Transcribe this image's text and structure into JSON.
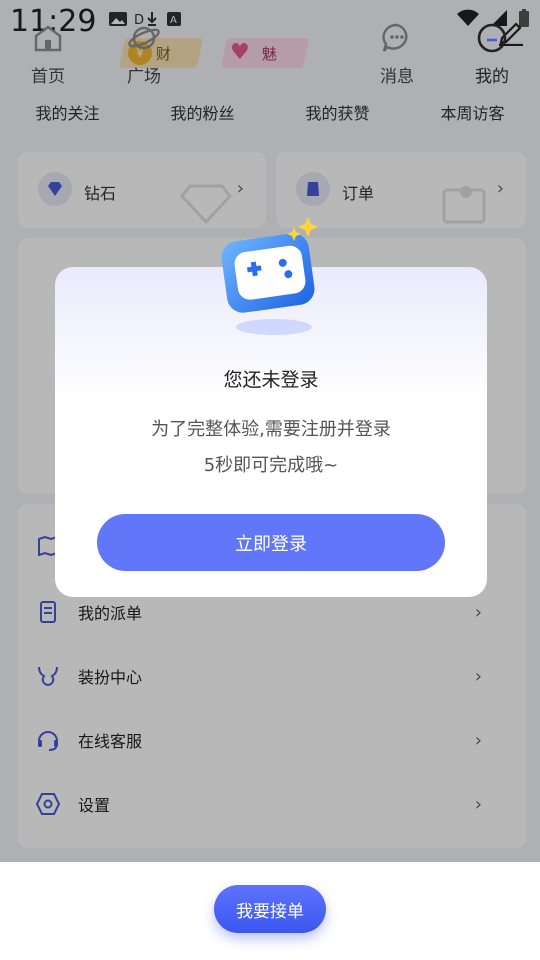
{
  "status_bar": {
    "time": "11:29"
  },
  "badges": {
    "wealth_label": "财",
    "charm_label": "魅"
  },
  "stats": [
    "我的关注",
    "我的粉丝",
    "我的获赞",
    "本周访客"
  ],
  "cards": {
    "diamond_label": "钻石",
    "order_label": "订单"
  },
  "menu": [
    {
      "label": "我的派单",
      "icon": "list-icon"
    },
    {
      "label": "装扮中心",
      "icon": "horns-icon"
    },
    {
      "label": "在线客服",
      "icon": "headset-icon"
    },
    {
      "label": "设置",
      "icon": "settings-icon"
    }
  ],
  "modal": {
    "title": "您还未登录",
    "line1": "为了完整体验,需要注册并登录",
    "line2": "5秒即可完成哦~",
    "login_label": "立即登录"
  },
  "tabbar": {
    "home": "首页",
    "plaza": "广场",
    "cta": "我要接单",
    "messages": "消息",
    "mine": "我的"
  },
  "colors": {
    "accent": "#6176f8",
    "cta": "#3b55ef"
  }
}
